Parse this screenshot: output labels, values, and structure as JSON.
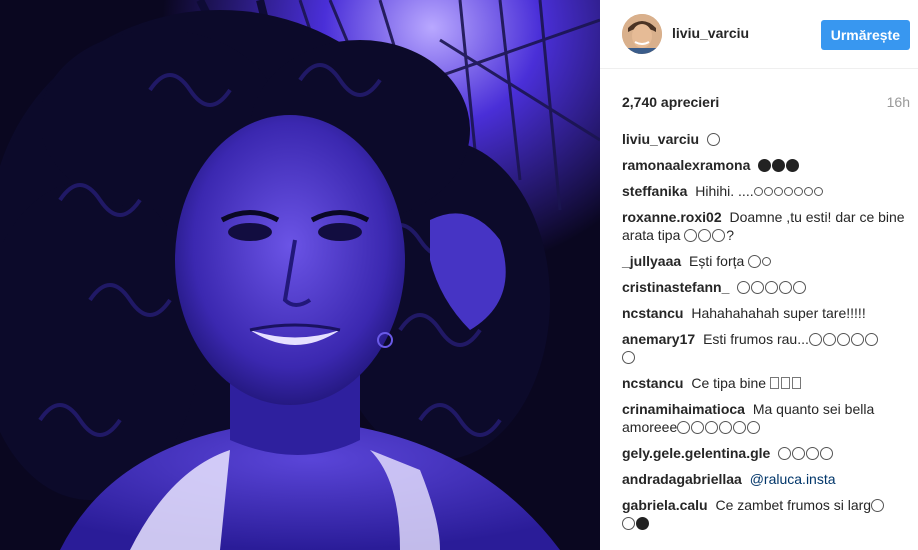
{
  "post": {
    "username": "liviu_varciu",
    "follow_label": "Urmărește",
    "likes": "2,740 aprecieri",
    "time": "16h"
  },
  "comments": [
    {
      "user": "liviu_varciu",
      "text": ""
    },
    {
      "user": "ramonaalexramona",
      "text": ""
    },
    {
      "user": "steffanika",
      "text": "Hihihi. ...."
    },
    {
      "user": "roxanne.roxi02",
      "text": "Doamne ,tu esti! dar ce bine arata tipa"
    },
    {
      "user": "_jullyaaa",
      "text": "Ești forța"
    },
    {
      "user": "cristinastefann_",
      "text": ""
    },
    {
      "user": "ncstancu",
      "text": "Hahahahahah super tare!!!!!"
    },
    {
      "user": "anemary17",
      "text": "Esti frumos rau..."
    },
    {
      "user": "ncstancu",
      "text": "Ce tipa bine"
    },
    {
      "user": "crinamihaimatioca",
      "text": "Ma quanto sei bella amoreee"
    },
    {
      "user": "gely.gele.gelentina.gle",
      "text": ""
    },
    {
      "user": "andradagabriellaa",
      "text": "",
      "mention": "@raluca.insta"
    },
    {
      "user": "gabriela.calu",
      "text": "Ce zambet frumos si larg"
    }
  ],
  "colors": {
    "follow_button": "#3897f0",
    "photo_tone": "#3a2ad0",
    "mention": "#003569"
  }
}
